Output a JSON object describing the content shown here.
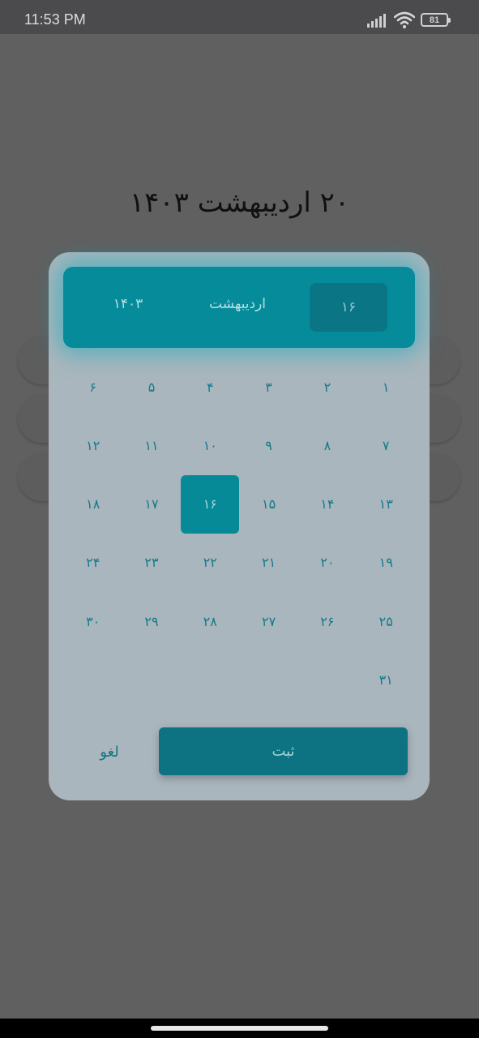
{
  "status_bar": {
    "time": "11:53 PM",
    "battery": "81",
    "icons": [
      "signal-icon",
      "wifi-icon",
      "battery-icon"
    ]
  },
  "background": {
    "title": "۲۰ اردیبهشت ۱۴۰۳"
  },
  "dialog": {
    "header": {
      "year": "۱۴۰۳",
      "month": "اردیبهشت",
      "day": "۱۶"
    },
    "days": [
      "۱",
      "۲",
      "۳",
      "۴",
      "۵",
      "۶",
      "۷",
      "۸",
      "۹",
      "۱۰",
      "۱۱",
      "۱۲",
      "۱۳",
      "۱۴",
      "۱۵",
      "۱۶",
      "۱۷",
      "۱۸",
      "۱۹",
      "۲۰",
      "۲۱",
      "۲۲",
      "۲۳",
      "۲۴",
      "۲۵",
      "۲۶",
      "۲۷",
      "۲۸",
      "۲۹",
      "۳۰",
      "۳۱"
    ],
    "selected_day": 16,
    "confirm_label": "ثبت",
    "cancel_label": "لغو"
  },
  "colors": {
    "accent": "#068b9b",
    "dialog_bg": "#a9b6bd",
    "scrim": "#606060"
  }
}
